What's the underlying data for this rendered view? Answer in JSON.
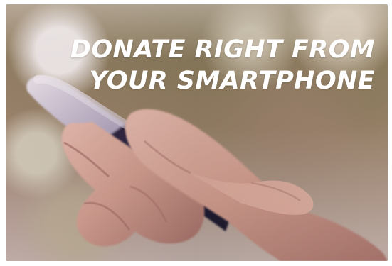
{
  "banner": {
    "headline_lines": [
      "DONATE RIGHT FROM",
      "YOUR SMARTPHONE"
    ]
  },
  "colors": {
    "headline": "#ffffff",
    "skin_light": "#dfb2a3",
    "skin_mid": "#c58f7d",
    "skin_shadow": "#9f6c62",
    "phone_dark": "#1d1834",
    "phone_light": "#ece8f2",
    "background_warm": "#9b8663"
  },
  "icons": {
    "scene": "smartphone-in-hands-image"
  }
}
